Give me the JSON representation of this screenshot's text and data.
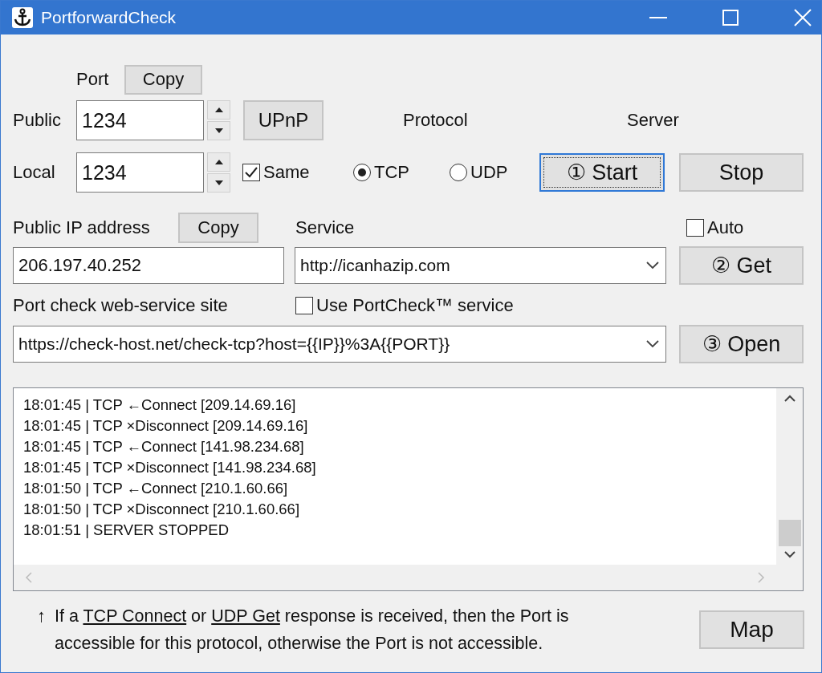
{
  "window": {
    "title": "PortforwardCheck"
  },
  "port": {
    "label": "Port",
    "copy_button": "Copy",
    "rows": [
      {
        "label": "Public",
        "value": "1234"
      },
      {
        "label": "Local",
        "value": "1234"
      }
    ]
  },
  "upnp_button": {
    "label": "UPnP"
  },
  "same": {
    "label": "Same",
    "checked": true
  },
  "protocol": {
    "label": "Protocol",
    "options": [
      {
        "label": "TCP",
        "selected": true
      },
      {
        "label": "UDP",
        "selected": false
      }
    ]
  },
  "server": {
    "label": "Server",
    "buttons": [
      {
        "label": "① Start",
        "focused": true
      },
      {
        "label": "Stop",
        "focused": false
      }
    ]
  },
  "public_ip": {
    "label": "Public IP address",
    "copy_button": "Copy",
    "value": "206.197.40.252"
  },
  "service": {
    "label": "Service",
    "value": "http://icanhazip.com"
  },
  "auto": {
    "label": "Auto",
    "checked": false
  },
  "get_button": "② Get",
  "port_check": {
    "label": "Port check web-service site",
    "use_portcheck": {
      "label": "Use PortCheck™ service",
      "checked": false
    },
    "value": "https://check-host.net/check-tcp?host={{IP}}%3A{{PORT}}",
    "open_button": "③ Open"
  },
  "log": {
    "lines": [
      "18:01:45 | TCP ←Connect [209.14.69.16]",
      "18:01:45 | TCP ×Disconnect [209.14.69.16]",
      "18:01:45 | TCP ←Connect [141.98.234.68]",
      "18:01:45 | TCP ×Disconnect [141.98.234.68]",
      "18:01:50 | TCP ←Connect [210.1.60.66]",
      "18:01:50 | TCP ×Disconnect [210.1.60.66]",
      "18:01:51 | SERVER STOPPED"
    ]
  },
  "help": {
    "arrow": "↑",
    "parts": [
      {
        "kind": "plain",
        "text": "If a "
      },
      {
        "kind": "link",
        "text": "TCP Connect"
      },
      {
        "kind": "plain",
        "text": " or "
      },
      {
        "kind": "link",
        "text": "UDP Get"
      },
      {
        "kind": "plain",
        "text": " response is received, then the Port is accessible for this protocol, otherwise the Port is not accessible."
      }
    ]
  },
  "map_button": {
    "label": "Map"
  }
}
